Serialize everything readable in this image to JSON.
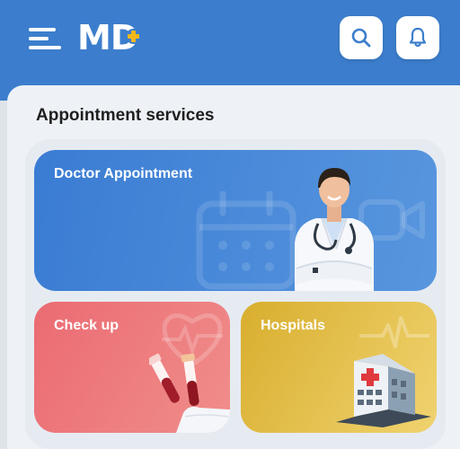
{
  "header": {
    "logo_text": "MD",
    "menu_icon": "hamburger-menu-icon",
    "search_icon": "search-icon",
    "bell_icon": "bell-icon",
    "brand_color": "#3c7ecd",
    "logo_accent": "#f5b81c"
  },
  "section": {
    "title": "Appointment services"
  },
  "cards": {
    "doctor": {
      "label": "Doctor Appointment",
      "icon": "doctor-photo",
      "color": "#3a7cd3"
    },
    "checkup": {
      "label": "Check up",
      "icon": "blood-test-tubes-icon",
      "color": "#eb6b73"
    },
    "hospital": {
      "label": "Hospitals",
      "icon": "hospital-building-icon",
      "color": "#e0b93e"
    }
  }
}
